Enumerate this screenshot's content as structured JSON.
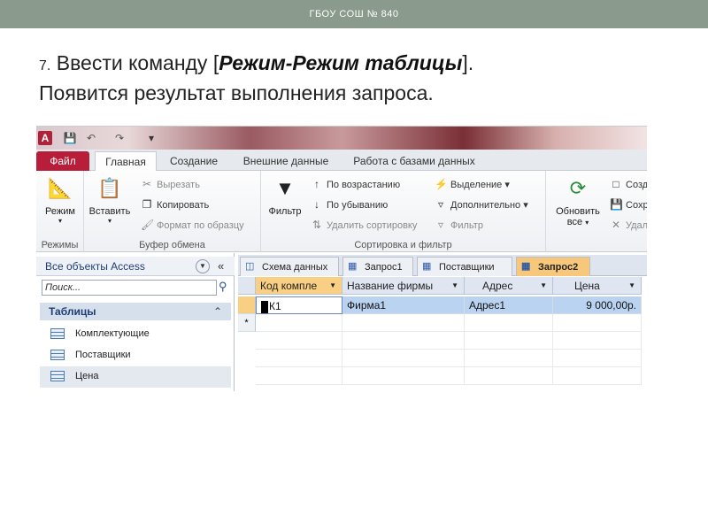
{
  "slide": {
    "header": "ГБОУ СОШ № 840",
    "step_number": "7.",
    "line1_before": " Ввести команду [",
    "line1_command": "Режим-Режим таблицы",
    "line1_after": "].",
    "line2": "Появится результат выполнения запроса."
  },
  "app": {
    "tabs": [
      "Файл",
      "Главная",
      "Создание",
      "Внешние данные",
      "Работа с базами данных"
    ],
    "active_tab": "Главная",
    "ribbon": {
      "groups": [
        {
          "label": "Режимы",
          "big_button": "Режим"
        },
        {
          "label": "Буфер обмена",
          "big_button": "Вставить",
          "small": [
            "Вырезать",
            "Копировать",
            "Формат по образцу"
          ]
        },
        {
          "label": "Сортировка и фильтр",
          "big_button": "Фильтр",
          "small": [
            "По возрастанию",
            "По убыванию",
            "Удалить сортировку",
            "Выделение",
            "Дополнительно",
            "Фильтр"
          ]
        },
        {
          "big_button": "Обновить",
          "big_button_line2": "все",
          "small": [
            "Созд",
            "Сохр",
            "Удал"
          ]
        }
      ]
    },
    "nav": {
      "title": "Все объекты Access",
      "search_placeholder": "Поиск...",
      "section": "Таблицы",
      "items": [
        "Комплектующие",
        "Поставщики",
        "Цена"
      ]
    },
    "doc_tabs": [
      "Схема данных",
      "Запрос1",
      "Поставщики",
      "Запрос2"
    ],
    "active_doc_tab": "Запрос2",
    "columns": [
      "Код компле",
      "Название фирмы",
      "Адрес",
      "Цена"
    ],
    "rows": [
      [
        "К1",
        "Фирма1",
        "Адрес1",
        "9 000,00р."
      ]
    ],
    "new_row_marker": "*"
  }
}
